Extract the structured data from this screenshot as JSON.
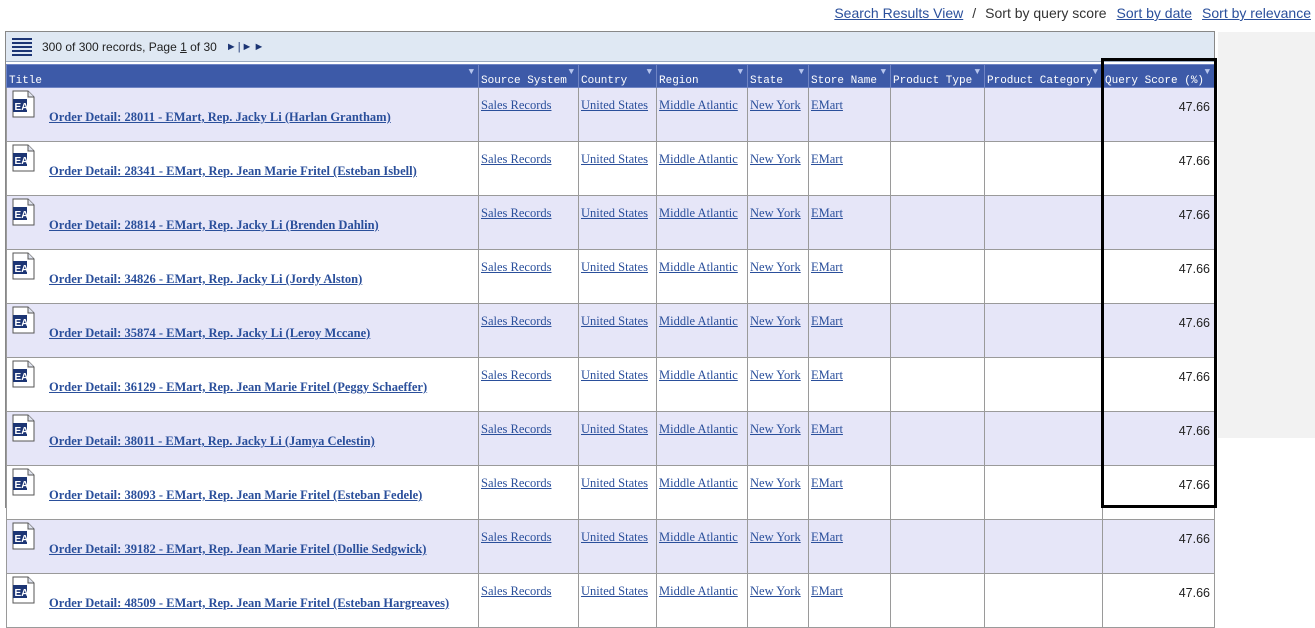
{
  "topnav": {
    "search_results_view": "Search Results View",
    "separator": "/",
    "current_sort": "Sort by query score",
    "sort_by_date": "Sort by date",
    "sort_by_relevance": "Sort by relevance"
  },
  "toolbar": {
    "records_text": "300 of 300 records, Page ",
    "page_current": "1",
    "page_of": " of 30",
    "pager_nav": "►|►►"
  },
  "columns": [
    {
      "label": "Title"
    },
    {
      "label": "Source System"
    },
    {
      "label": "Country"
    },
    {
      "label": "Region"
    },
    {
      "label": "State"
    },
    {
      "label": "Store Name"
    },
    {
      "label": "Product Type"
    },
    {
      "label": "Product Category"
    },
    {
      "label": "Query Score (%)"
    }
  ],
  "sort_glyph": "▼",
  "rows": [
    {
      "title": "Order Detail: 28011 - EMart, Rep. Jacky Li (Harlan Grantham)",
      "source": "Sales Records",
      "country": "United States",
      "region": "Middle Atlantic",
      "state": "New York",
      "store": "EMart",
      "product_type": "",
      "product_category": "",
      "score": "47.66"
    },
    {
      "title": "Order Detail: 28341 - EMart, Rep. Jean Marie Fritel (Esteban Isbell)",
      "source": "Sales Records",
      "country": "United States",
      "region": "Middle Atlantic",
      "state": "New York",
      "store": "EMart",
      "product_type": "",
      "product_category": "",
      "score": "47.66"
    },
    {
      "title": "Order Detail: 28814 - EMart, Rep. Jacky Li (Brenden Dahlin)",
      "source": "Sales Records",
      "country": "United States",
      "region": "Middle Atlantic",
      "state": "New York",
      "store": "EMart",
      "product_type": "",
      "product_category": "",
      "score": "47.66"
    },
    {
      "title": "Order Detail: 34826 - EMart, Rep. Jacky Li (Jordy Alston)",
      "source": "Sales Records",
      "country": "United States",
      "region": "Middle Atlantic",
      "state": "New York",
      "store": "EMart",
      "product_type": "",
      "product_category": "",
      "score": "47.66"
    },
    {
      "title": "Order Detail: 35874 - EMart, Rep. Jacky Li (Leroy Mccane)",
      "source": "Sales Records",
      "country": "United States",
      "region": "Middle Atlantic",
      "state": "New York",
      "store": "EMart",
      "product_type": "",
      "product_category": "",
      "score": "47.66"
    },
    {
      "title": "Order Detail: 36129 - EMart, Rep. Jean Marie Fritel (Peggy Schaeffer)",
      "source": "Sales Records",
      "country": "United States",
      "region": "Middle Atlantic",
      "state": "New York",
      "store": "EMart",
      "product_type": "",
      "product_category": "",
      "score": "47.66"
    },
    {
      "title": "Order Detail: 38011 - EMart, Rep. Jacky Li (Jamya Celestin)",
      "source": "Sales Records",
      "country": "United States",
      "region": "Middle Atlantic",
      "state": "New York",
      "store": "EMart",
      "product_type": "",
      "product_category": "",
      "score": "47.66"
    },
    {
      "title": "Order Detail: 38093 - EMart, Rep. Jean Marie Fritel (Esteban Fedele)",
      "source": "Sales Records",
      "country": "United States",
      "region": "Middle Atlantic",
      "state": "New York",
      "store": "EMart",
      "product_type": "",
      "product_category": "",
      "score": "47.66"
    },
    {
      "title": "Order Detail: 39182 - EMart, Rep. Jean Marie Fritel (Dollie Sedgwick)",
      "source": "Sales Records",
      "country": "United States",
      "region": "Middle Atlantic",
      "state": "New York",
      "store": "EMart",
      "product_type": "",
      "product_category": "",
      "score": "47.66"
    },
    {
      "title": "Order Detail: 48509 - EMart, Rep. Jean Marie Fritel (Esteban Hargreaves)",
      "source": "Sales Records",
      "country": "United States",
      "region": "Middle Atlantic",
      "state": "New York",
      "store": "EMart",
      "product_type": "",
      "product_category": "",
      "score": "47.66"
    }
  ],
  "icons": {
    "toolbar": "list-view-icon",
    "row": "document-icon"
  },
  "colors": {
    "header_bg": "#3d5aa8",
    "link": "#2a4f9b",
    "row_alt": "#e6e6f8",
    "toolbar_bg": "#dfe8f3"
  }
}
